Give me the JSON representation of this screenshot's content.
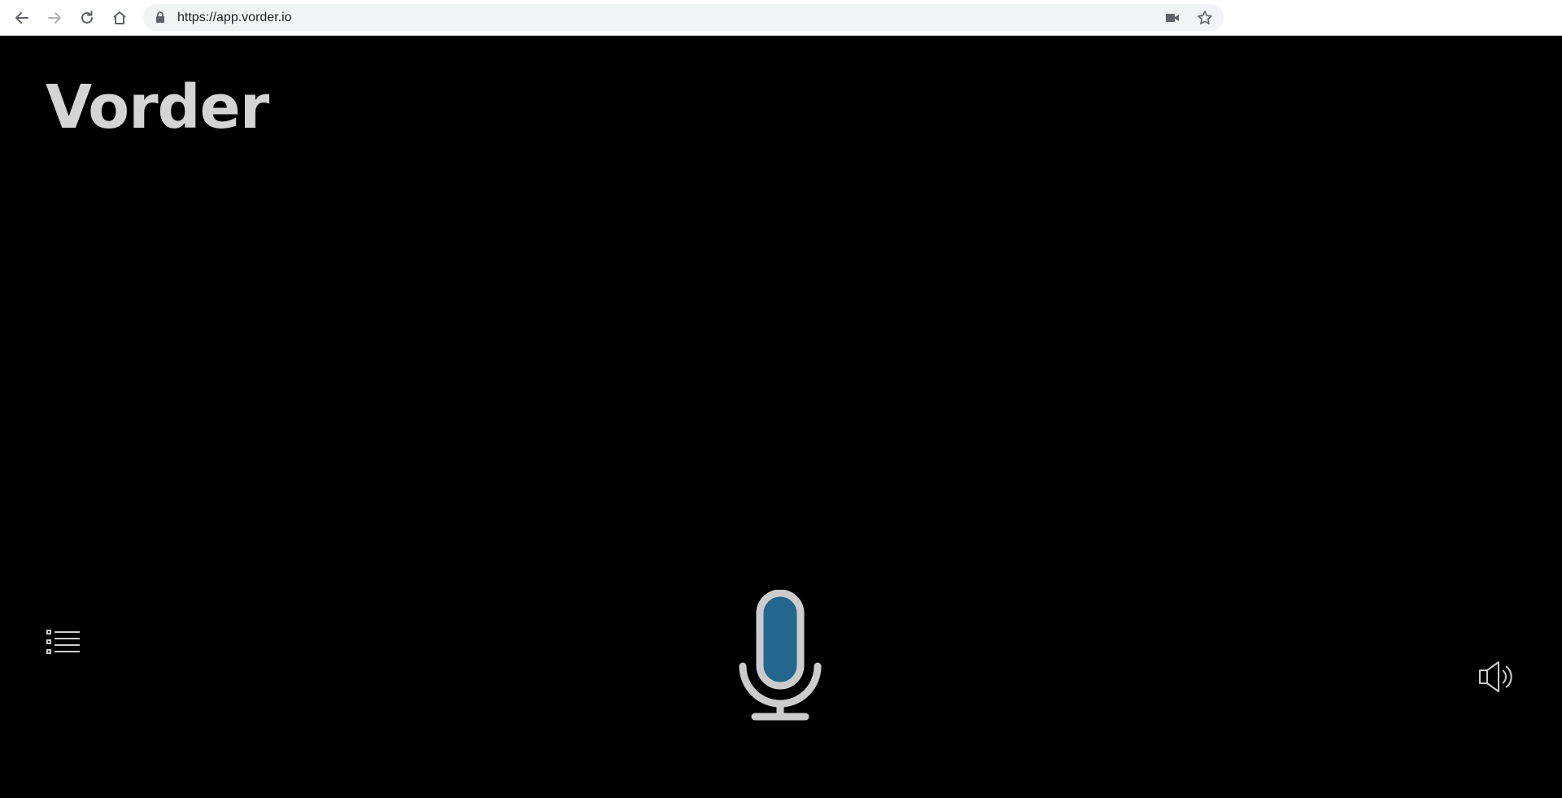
{
  "browser": {
    "url": "https://app.vorder.io",
    "back_icon": "arrow-left-icon",
    "forward_icon": "arrow-right-icon",
    "reload_icon": "reload-icon",
    "home_icon": "home-icon",
    "lock_icon": "lock-icon",
    "camera_icon": "video-camera-icon",
    "bookmark_icon": "star-icon"
  },
  "app": {
    "title": "Vorder",
    "list_icon": "list-icon",
    "mic_icon": "microphone-icon",
    "speaker_icon": "speaker-icon",
    "colors": {
      "background": "#000000",
      "title": "#d4d4d4",
      "icon": "#cccccc",
      "mic_fill": "#23678f"
    }
  }
}
